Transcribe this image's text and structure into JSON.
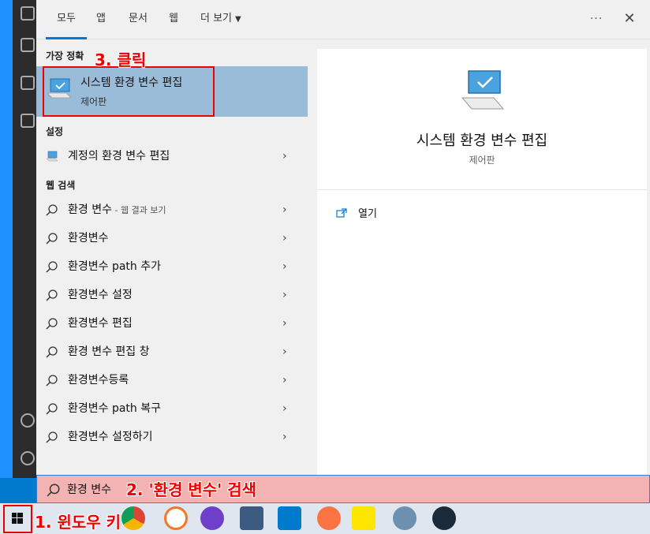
{
  "tabs": [
    {
      "label": "모두",
      "active": true
    },
    {
      "label": "앱"
    },
    {
      "label": "문서"
    },
    {
      "label": "웹"
    },
    {
      "label": "더 보기"
    }
  ],
  "more_icon": "···",
  "close_icon": "✕",
  "sections": {
    "best_match": "가장 정확",
    "settings": "설정",
    "web_search": "웹 검색"
  },
  "best_match": {
    "title": "시스템 환경 변수 편집",
    "subtitle": "제어판"
  },
  "settings_items": [
    {
      "label": "계정의 환경 변수 편집"
    }
  ],
  "web_items": [
    {
      "label": "환경 변수",
      "suffix": " - 웹 결과 보기"
    },
    {
      "label": "환경변수"
    },
    {
      "label": "환경변수 path 추가"
    },
    {
      "label": "환경변수 설정"
    },
    {
      "label": "환경변수 편집"
    },
    {
      "label": "환경 변수 편집 창"
    },
    {
      "label": "환경변수등록"
    },
    {
      "label": "환경변수 path 복구"
    },
    {
      "label": "환경변수 설정하기"
    }
  ],
  "detail": {
    "title": "시스템 환경 변수 편집",
    "subtitle": "제어판",
    "open_label": "열기"
  },
  "search": {
    "value": "환경 변수"
  },
  "annotations": {
    "step1": "1. 윈도우 키",
    "step2": "2. '환경 변수' 검색",
    "step3": "3. 클릭"
  },
  "colors": {
    "accent": "#0078d7",
    "highlight": "#99bcd9",
    "annotation": "#ee0000"
  },
  "taskbar_icons": [
    "chrome-icon",
    "jupyter-icon",
    "github-desktop-icon",
    "mysql-workbench-icon",
    "vscode-icon",
    "swift-icon",
    "kakaotalk-icon",
    "vlc-icon",
    "nox-icon"
  ]
}
